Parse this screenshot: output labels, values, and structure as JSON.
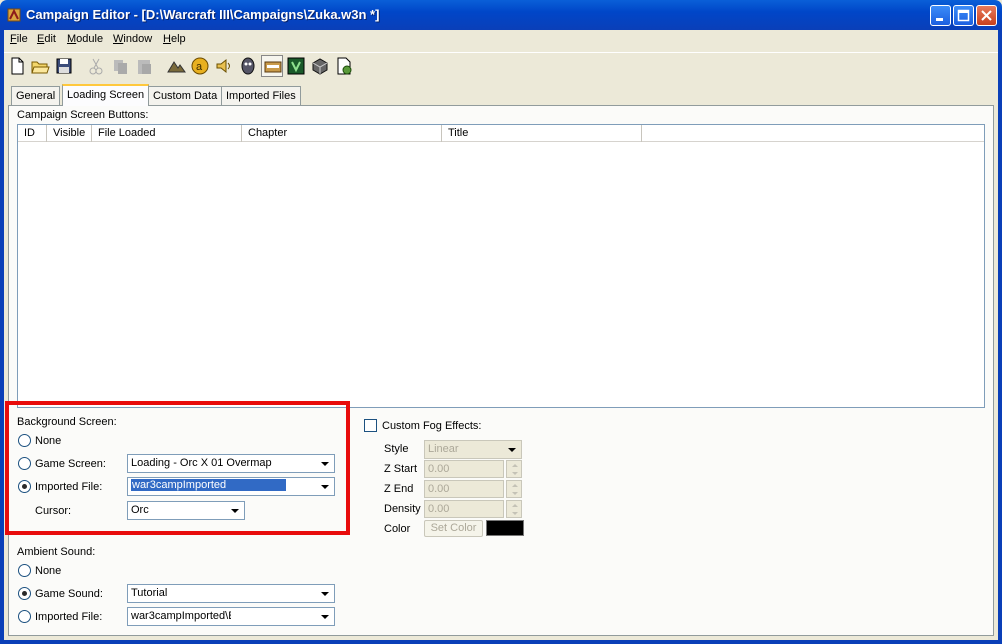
{
  "window": {
    "title": "Campaign Editor - [D:\\Warcraft III\\Campaigns\\Zuka.w3n *]"
  },
  "menu": [
    {
      "label_u": "F",
      "label_rest": "ile"
    },
    {
      "label_u": "E",
      "label_rest": "dit"
    },
    {
      "label_u": "M",
      "label_rest": "odule"
    },
    {
      "label_u": "W",
      "label_rest": "indow"
    },
    {
      "label_u": "H",
      "label_rest": "elp"
    }
  ],
  "tabs": [
    "General",
    "Loading Screen",
    "Custom Data",
    "Imported Files"
  ],
  "buttons_section": {
    "label": "Campaign Screen Buttons:",
    "columns": [
      "ID",
      "Visible",
      "File Loaded",
      "Chapter",
      "Title"
    ]
  },
  "background": {
    "label": "Background Screen:",
    "none_label": "None",
    "game_screen_label": "Game Screen:",
    "game_screen_value": "Loading - Orc X 01 Overmap",
    "imported_file_label": "Imported File:",
    "imported_file_value": "war3campImported",
    "cursor_label": "Cursor:",
    "cursor_value": "Orc",
    "selected": "imported"
  },
  "fog": {
    "checkbox_label": "Custom Fog Effects:",
    "style_label": "Style",
    "style_value": "Linear",
    "zstart_label": "Z Start",
    "zstart_value": "0.00",
    "zend_label": "Z End",
    "zend_value": "0.00",
    "density_label": "Density",
    "density_value": "0.00",
    "color_label": "Color",
    "set_color_label": "Set Color",
    "color_value": "#000000"
  },
  "ambient": {
    "label": "Ambient Sound:",
    "none_label": "None",
    "game_sound_label": "Game Sound:",
    "game_sound_value": "Tutorial",
    "imported_file_label": "Imported File:",
    "imported_file_value": "war3campImported\\E",
    "selected": "game"
  },
  "colors": {
    "accent": "#316ac5",
    "highlight_box": "#e80c0c"
  }
}
